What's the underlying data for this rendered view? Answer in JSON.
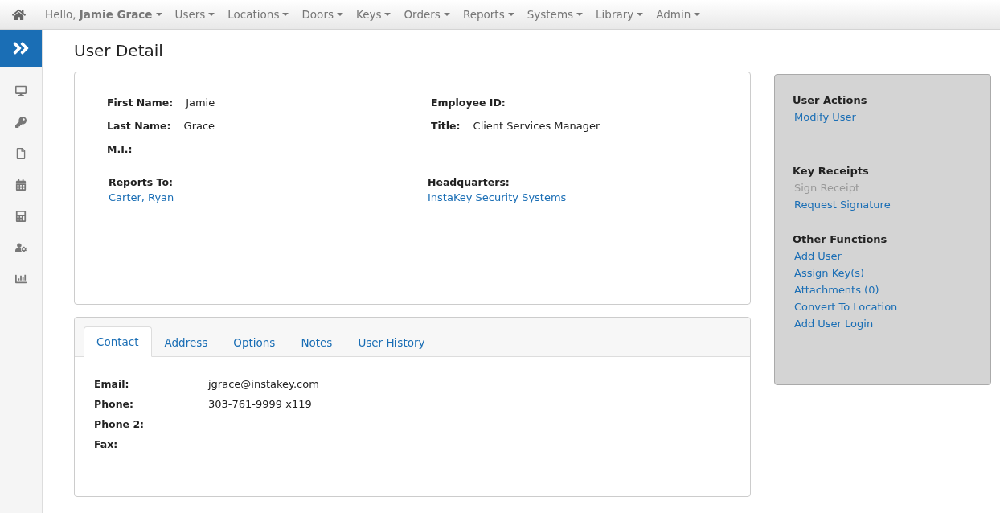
{
  "nav": {
    "greeting": "Hello, **Jamie Grace**",
    "menus": [
      "Users",
      "Locations",
      "Doors",
      "Keys",
      "Orders",
      "Reports",
      "Systems",
      "Library",
      "Admin"
    ]
  },
  "page_title": "User Detail",
  "details": {
    "left": [
      {
        "label": "First Name:",
        "value": "Jamie"
      },
      {
        "label": "Last Name:",
        "value": "Grace"
      },
      {
        "label": "M.I.:"
      }
    ],
    "right": [
      {
        "label": "Employee ID:"
      },
      {
        "label": "Title:",
        "value": "Client Services Manager"
      }
    ],
    "links": [
      {
        "label": "Reports To:",
        "link": "Carter, Ryan"
      },
      {
        "label": "Headquarters:",
        "link": "InstaKey Security Systems"
      }
    ]
  },
  "tabs": [
    {
      "label": "Contact",
      "selected": true
    },
    {
      "label": "Address",
      "selected": false
    },
    {
      "label": "Options",
      "selected": false
    },
    {
      "label": "Notes",
      "selected": false
    },
    {
      "label": "User History",
      "selected": false
    }
  ],
  "contact": [
    {
      "label": "Email:",
      "value": "jgrace@instakey.com"
    },
    {
      "label": "Phone:",
      "value": "303-761-9999 x119"
    },
    {
      "label": "Phone 2:"
    },
    {
      "label": "Fax:"
    }
  ],
  "actions": [
    {
      "title": "User Actions",
      "links": [
        {
          "label": "Modify User",
          "disabled": false
        }
      ]
    },
    {
      "title": "Key Receipts",
      "links": [
        {
          "label": "Sign Receipt",
          "disabled": true
        },
        {
          "label": "Request Signature",
          "disabled": false
        }
      ]
    },
    {
      "title": "Other Functions",
      "links": [
        {
          "label": "Add User",
          "disabled": false
        },
        {
          "label": "Assign Key(s)",
          "disabled": false
        },
        {
          "label": "Attachments (0)",
          "disabled": false
        },
        {
          "label": "Convert To Location",
          "disabled": false
        },
        {
          "label": "Add User Login",
          "disabled": false
        }
      ]
    }
  ]
}
